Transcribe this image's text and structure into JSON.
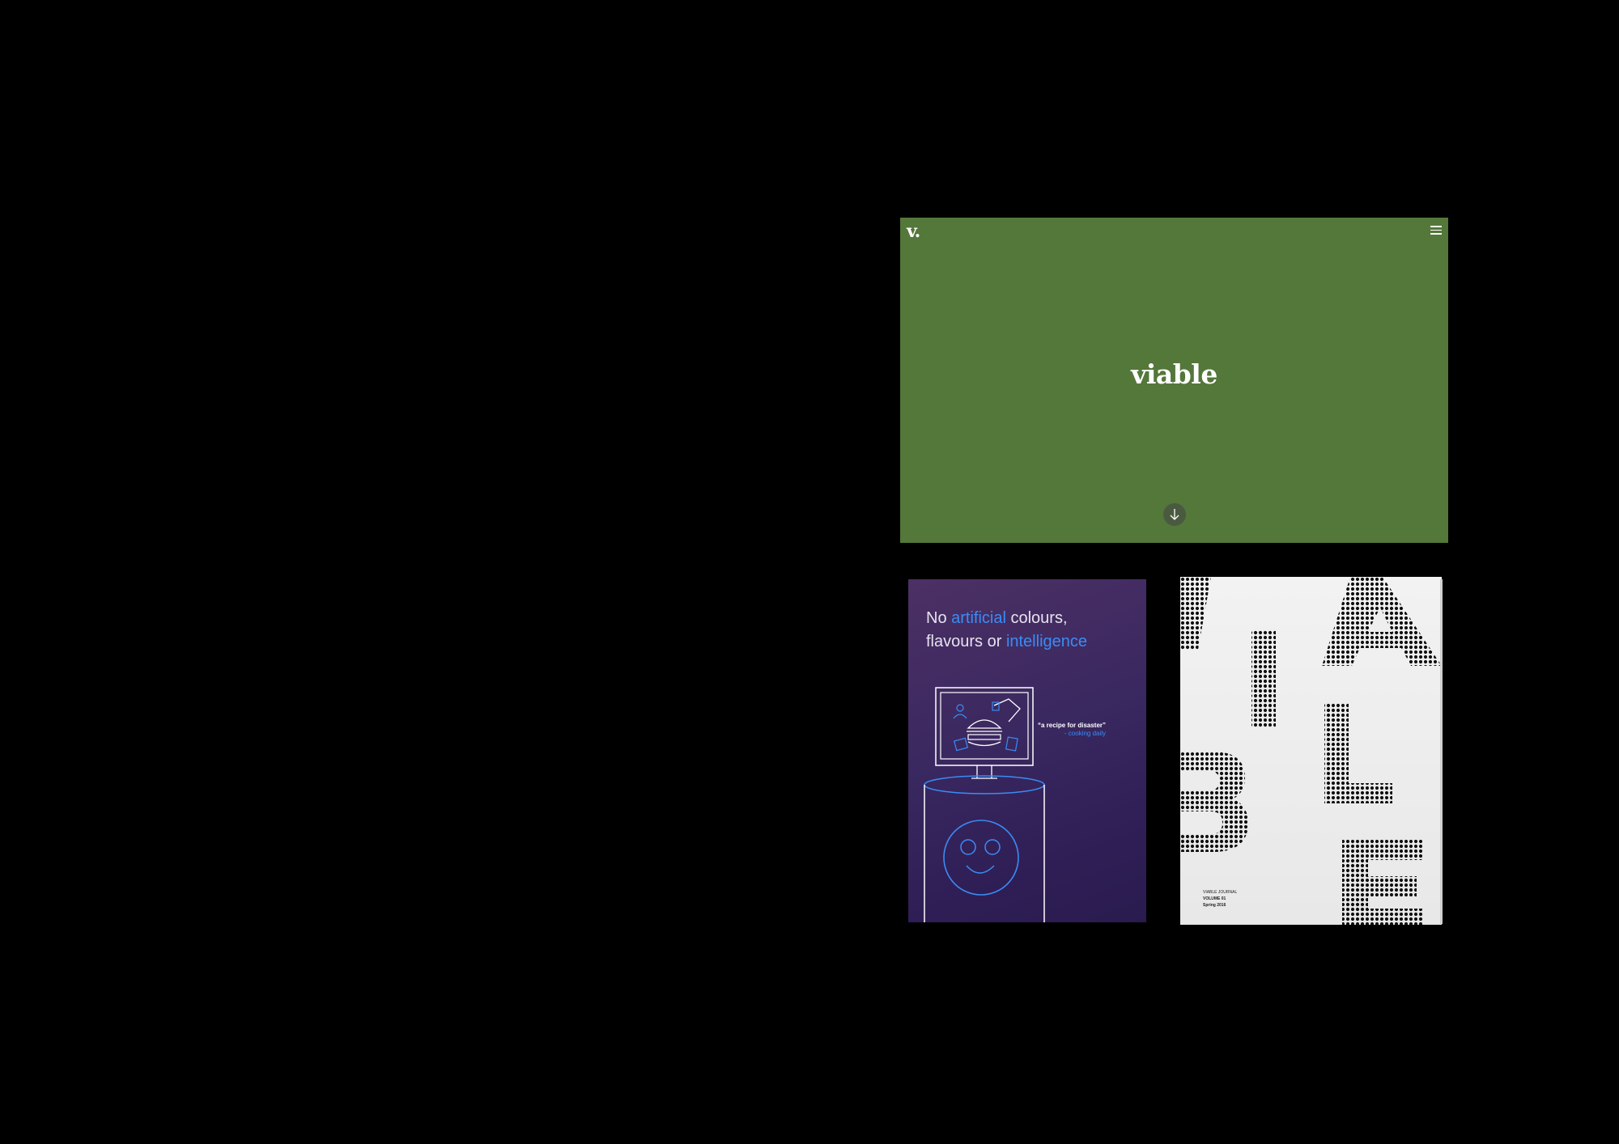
{
  "site": {
    "logo": "v.",
    "title": "viable",
    "menu_icon": "hamburger-icon",
    "scroll_icon": "arrow-down-icon",
    "background": "#54773a"
  },
  "magazine_purple": {
    "headline": {
      "word1": "No ",
      "word2": "artificial",
      "word3": " colours,",
      "word4": "flavours or ",
      "word5": "intelligence"
    },
    "quote": "“a recipe for disaster”",
    "quote_source": "- cooking daily",
    "accent": "#3a8cf5"
  },
  "magazine_white": {
    "letters": [
      "V",
      "I",
      "A",
      "B",
      "L",
      "E"
    ],
    "journal_label": "VIABLE JOURNAL",
    "volume": "VOLUME 01",
    "season": "Spring 2016"
  }
}
